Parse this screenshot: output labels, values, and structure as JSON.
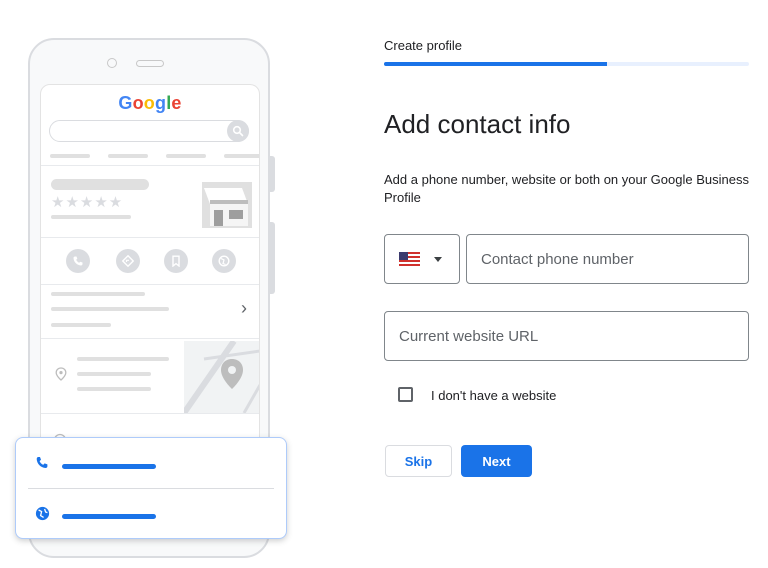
{
  "illustration": {
    "logo": [
      "G",
      "o",
      "o",
      "g",
      "l",
      "e"
    ],
    "logo_colors": [
      "#4285F4",
      "#EA4335",
      "#FBBC05",
      "#4285F4",
      "#34A853",
      "#EA4335"
    ],
    "stars": "★★★★★",
    "chevron": "›",
    "icons": [
      "phone-icon",
      "directions-icon",
      "bookmark-icon",
      "website-icon",
      "store-icon",
      "location-pin-icon",
      "clock-icon"
    ],
    "card_icons": [
      "phone-icon",
      "globe-icon"
    ],
    "accent_color": "#1a73e8"
  },
  "header": {
    "step_label": "Create profile",
    "progress_percent": 61
  },
  "main": {
    "title": "Add contact info",
    "description": "Add a phone number, website or both on your Google Business Profile",
    "country_select": {
      "selected_flag": "US flag"
    },
    "phone_field": {
      "placeholder": "Contact phone number",
      "value": ""
    },
    "url_field": {
      "placeholder": "Current website URL",
      "value": ""
    },
    "no_website_checkbox": {
      "label": "I don't have a website",
      "checked": false
    }
  },
  "actions": {
    "skip_label": "Skip",
    "next_label": "Next"
  }
}
